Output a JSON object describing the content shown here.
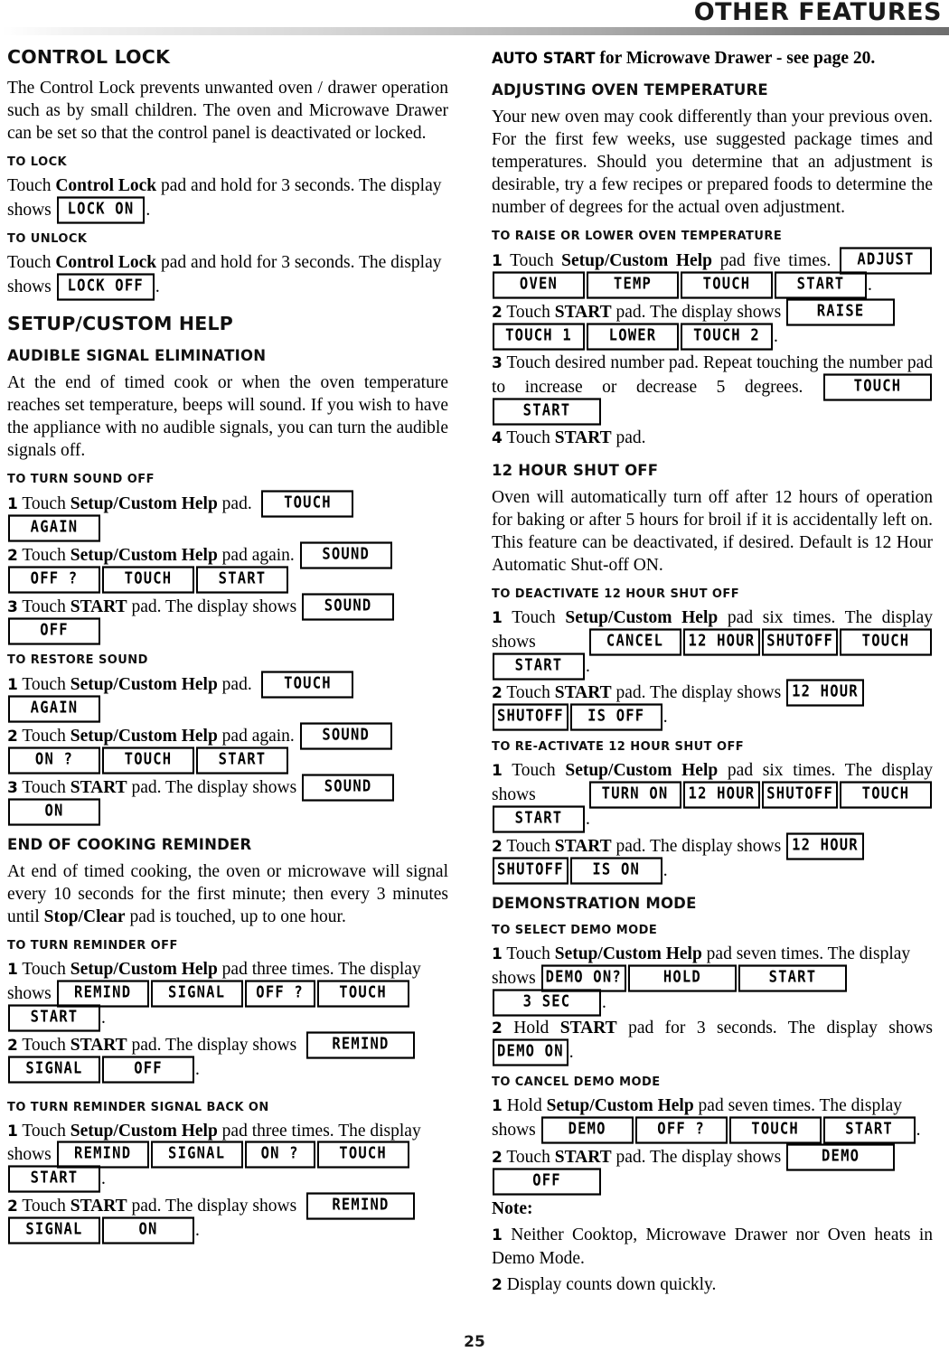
{
  "header": {
    "title": "OTHER FEATURES"
  },
  "page_number": "25",
  "left_column": {
    "control_lock": {
      "heading": "CONTROL LOCK",
      "intro": "The Control Lock prevents unwanted oven / drawer operation such as by small children. The oven and Microwave Drawer can be set so that the control panel is deactivated or locked.",
      "to_lock": {
        "heading": "TO LOCK",
        "text_before": "Touch ",
        "pad": "Control Lock",
        "text_after": " pad and hold for 3 seconds. The display shows ",
        "display": "LOCK ON",
        "period": "."
      },
      "to_unlock": {
        "heading": "TO UNLOCK",
        "text_before": "Touch ",
        "pad": "Control Lock",
        "text_after": " pad and hold for 3 seconds. The display shows ",
        "display": "LOCK OFF",
        "period": "."
      }
    },
    "setup_custom_help": {
      "heading": "SETUP/CUSTOM HELP",
      "audible_signal": {
        "heading": "AUDIBLE SIGNAL ELIMINATION",
        "intro": "At the end of timed cook or when the oven temperature reaches set temperature, beeps will sound. If you wish to have the appliance with no audible signals, you can turn the audible signals off."
      },
      "turn_sound_off": {
        "heading": "TO TURN SOUND OFF",
        "steps": [
          {
            "num": "1",
            "text_before": "Touch ",
            "pad": "Setup/Custom Help",
            "text_after": " pad.",
            "displays": [
              "TOUCH",
              "AGAIN"
            ]
          },
          {
            "num": "2",
            "text_before": "Touch ",
            "pad": "Setup/Custom Help",
            "text_after": " pad again.",
            "displays": [
              "SOUND",
              "OFF ?",
              "TOUCH",
              "START"
            ]
          },
          {
            "num": "3",
            "text_before": "Touch ",
            "pad": "START",
            "text_after": " pad. The display shows ",
            "displays": [
              "SOUND",
              "OFF"
            ]
          }
        ]
      },
      "restore_sound": {
        "heading": "TO RESTORE SOUND",
        "steps": [
          {
            "num": "1",
            "text_before": "Touch ",
            "pad": "Setup/Custom Help",
            "text_after": " pad.",
            "displays": [
              "TOUCH",
              "AGAIN"
            ]
          },
          {
            "num": "2",
            "text_before": "Touch ",
            "pad": "Setup/Custom Help",
            "text_after": " pad again.",
            "displays": [
              "SOUND",
              "ON ?",
              "TOUCH",
              "START"
            ]
          },
          {
            "num": "3",
            "text_before": "Touch ",
            "pad": "START",
            "text_after": " pad. The display shows ",
            "displays": [
              "SOUND",
              "ON"
            ]
          }
        ]
      }
    },
    "end_of_cooking_reminder": {
      "heading": "END OF COOKING REMINDER",
      "intro_a": "At end of timed cooking, the oven or microwave will signal every 10 seconds for the first minute; then every 3 minutes until ",
      "intro_pad": "Stop/Clear",
      "intro_b": " pad is touched, up to one hour.",
      "turn_reminder_off": {
        "heading": "TO TURN REMINDER OFF",
        "steps": [
          {
            "num": "1",
            "text_before": "Touch ",
            "pad": "Setup/Custom Help",
            "text_after": " pad three times. The display shows ",
            "displays": [
              "REMIND",
              "SIGNAL",
              "OFF ?",
              "TOUCH",
              "START"
            ],
            "period": "."
          },
          {
            "num": "2",
            "text_before": "Touch ",
            "pad": "START",
            "text_after": " pad. The display shows ",
            "displays": [
              "REMIND",
              "SIGNAL",
              "OFF"
            ],
            "period": "."
          }
        ]
      },
      "turn_reminder_on": {
        "heading": "TO TURN REMINDER SIGNAL BACK ON",
        "steps": [
          {
            "num": "1",
            "text_before": "Touch ",
            "pad": "Setup/Custom Help",
            "text_after": " pad three times. The display shows ",
            "displays": [
              "REMIND",
              "SIGNAL",
              "ON ?",
              "TOUCH",
              "START"
            ],
            "period": "."
          },
          {
            "num": "2",
            "text_before": "Touch ",
            "pad": "START",
            "text_after": " pad. The display shows ",
            "displays": [
              "REMIND",
              "SIGNAL",
              "ON"
            ],
            "period": "."
          }
        ]
      }
    }
  },
  "right_column": {
    "auto_start": {
      "bold_part": "AUTO START",
      "rest": " for Microwave Drawer - see page 20."
    },
    "adjusting_oven_temperature": {
      "heading": "ADJUSTING OVEN TEMPERATURE",
      "intro": "Your new oven may cook differently than your previous oven. For the first few weeks, use suggested package times and temperatures. Should you determine that an adjustment is desirable, try a few recipes or prepared foods to determine the number of degrees for the actual oven adjustment.",
      "raise_or_lower": {
        "heading": "TO RAISE OR LOWER OVEN TEMPERATURE",
        "steps": [
          {
            "num": "1",
            "text_before": "Touch ",
            "pad": "Setup/Custom Help",
            "text_after": " pad five times. ",
            "displays": [
              "ADJUST",
              "OVEN",
              "TEMP",
              "TOUCH",
              "START"
            ],
            "period": "."
          },
          {
            "num": "2",
            "text_before": "Touch ",
            "pad": "START",
            "text_after": " pad. The display shows ",
            "displays": [
              "RAISE",
              "TOUCH 1",
              "LOWER",
              "TOUCH 2"
            ],
            "period": "."
          },
          {
            "num": "3",
            "text_before": "Touch desired number pad. Repeat touching the number pad to increase or decrease 5 degrees. ",
            "pad": "",
            "text_after": "",
            "displays": [
              "TOUCH",
              "START"
            ]
          },
          {
            "num": "4",
            "text_before": "Touch ",
            "pad": "START",
            "text_after": " pad.",
            "displays": []
          }
        ]
      }
    },
    "twelve_hour_shut_off": {
      "heading": "12 HOUR SHUT OFF",
      "intro": "Oven will automatically turn off after 12 hours of operation for baking or after 5 hours for broil if it is accidentally left on. This feature can be deactivated, if desired. Default is 12 Hour Automatic Shut-off ON.",
      "deactivate": {
        "heading": "TO DEACTIVATE 12 HOUR SHUT OFF",
        "steps": [
          {
            "num": "1",
            "text_before": "Touch ",
            "pad": "Setup/Custom Help",
            "text_after": " pad six times. The display shows ",
            "displays": [
              "CANCEL",
              "12 HOUR",
              "SHUTOFF",
              "TOUCH",
              "START"
            ],
            "period": "."
          },
          {
            "num": "2",
            "text_before": "Touch ",
            "pad": "START",
            "text_after": " pad. The display shows ",
            "displays": [
              "12 HOUR",
              "SHUTOFF",
              "IS OFF"
            ],
            "period": "."
          }
        ]
      },
      "reactivate": {
        "heading": "TO RE-ACTIVATE 12 HOUR SHUT OFF",
        "steps": [
          {
            "num": "1",
            "text_before": "Touch ",
            "pad": "Setup/Custom Help",
            "text_after": " pad six times. The display shows ",
            "displays": [
              "TURN ON",
              "12 HOUR",
              "SHUTOFF",
              "TOUCH",
              "START"
            ],
            "period": "."
          },
          {
            "num": "2",
            "text_before": "Touch ",
            "pad": "START",
            "text_after": " pad. The display shows ",
            "displays": [
              "12 HOUR",
              "SHUTOFF",
              "IS ON"
            ],
            "period": "."
          }
        ]
      }
    },
    "demonstration_mode": {
      "heading": "DEMONSTRATION MODE",
      "select_demo": {
        "heading": "TO SELECT DEMO MODE",
        "steps": [
          {
            "num": "1",
            "text_before": "Touch ",
            "pad": "Setup/Custom Help",
            "text_after": " pad seven times. The display shows ",
            "displays": [
              "DEMO ON?",
              "HOLD",
              "START",
              "3 SEC"
            ],
            "period": "."
          },
          {
            "num": "2",
            "text_before": "Hold ",
            "pad": "START",
            "text_after": " pad for 3 seconds. The display shows ",
            "displays": [
              "DEMO ON"
            ],
            "period": "."
          }
        ]
      },
      "cancel_demo": {
        "heading": "TO CANCEL DEMO MODE",
        "steps": [
          {
            "num": "1",
            "text_before": "Hold ",
            "pad": "Setup/Custom Help",
            "text_after": " pad seven times. The display shows ",
            "displays": [
              "DEMO",
              "OFF ?",
              "TOUCH",
              "START"
            ],
            "period": "."
          },
          {
            "num": "2",
            "text_before": "Touch ",
            "pad": "START",
            "text_after": " pad. The display shows ",
            "displays": [
              "DEMO",
              "OFF"
            ]
          }
        ]
      },
      "note": {
        "label": "Note:",
        "items": [
          {
            "num": "1",
            "text": "Neither Cooktop, Microwave Drawer nor Oven heats in Demo Mode."
          },
          {
            "num": "2",
            "text": "Display counts down quickly."
          }
        ]
      }
    }
  }
}
